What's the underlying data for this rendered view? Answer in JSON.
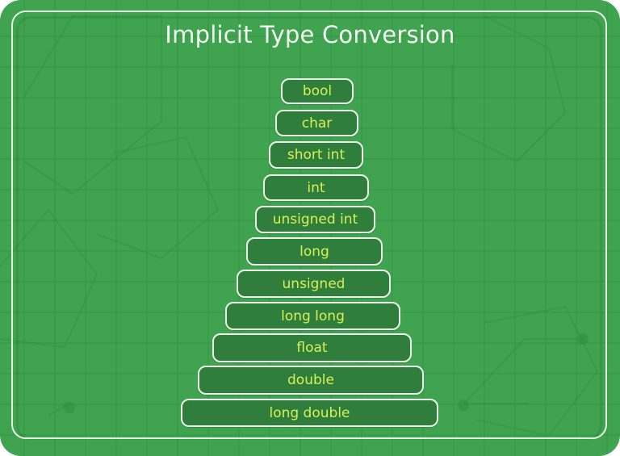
{
  "diagram": {
    "title": "Implicit Type Conversion",
    "type": "pyramid",
    "order": "top-to-bottom (lowest rank to highest rank)",
    "levels": [
      {
        "label": "bool"
      },
      {
        "label": "char"
      },
      {
        "label": "short int"
      },
      {
        "label": "int"
      },
      {
        "label": "unsigned int"
      },
      {
        "label": "long"
      },
      {
        "label": "unsigned"
      },
      {
        "label": "long long"
      },
      {
        "label": "float"
      },
      {
        "label": "double"
      },
      {
        "label": "long double"
      }
    ]
  },
  "colors": {
    "background": "#3fa34f",
    "box_fill": "#2f7e3b",
    "box_border": "#eef7ec",
    "label_text": "#d7ef5a",
    "title_text": "#f4fbf2"
  }
}
